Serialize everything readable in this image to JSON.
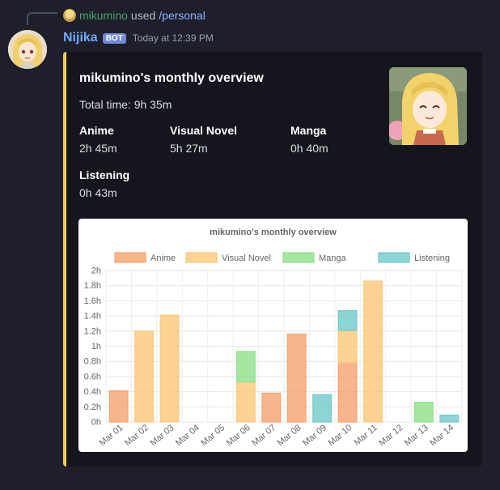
{
  "reply": {
    "user": "mikumino",
    "used": "used",
    "command": "/personal"
  },
  "message": {
    "author": "Nijika",
    "bot_tag": "BOT",
    "timestamp": "Today at 12:39 PM"
  },
  "embed": {
    "accent_color": "#f2cc5b",
    "title": "mikumino's monthly overview",
    "description": "Total time: 9h 35m",
    "fields": [
      {
        "name": "Anime",
        "value": "2h 45m"
      },
      {
        "name": "Visual Novel",
        "value": "5h 27m"
      },
      {
        "name": "Manga",
        "value": "0h 40m"
      },
      {
        "name": "Listening",
        "value": "0h 43m"
      }
    ]
  },
  "chart_data": {
    "type": "bar",
    "stacked": true,
    "title": "mikumino's monthly overview",
    "categories": [
      "Mar 01",
      "Mar 02",
      "Mar 03",
      "Mar 04",
      "Mar 05",
      "Mar 06",
      "Mar 07",
      "Mar 08",
      "Mar 09",
      "Mar 10",
      "Mar 11",
      "Mar 12",
      "Mar 13",
      "Mar 14"
    ],
    "yticks": [
      "0h",
      "0.2h",
      "0.4h",
      "0.6h",
      "0.8h",
      "1h",
      "1.2h",
      "1.4h",
      "1.6h",
      "1.8h",
      "2h"
    ],
    "ylim": [
      0,
      2
    ],
    "grid": true,
    "legend_position": "top",
    "series": [
      {
        "name": "Anime",
        "color": "#f5a26f",
        "values": [
          0.41,
          0,
          0,
          0,
          0,
          0,
          0.38,
          1.16,
          0,
          0.78,
          0,
          0,
          0,
          0
        ]
      },
      {
        "name": "Visual Novel",
        "color": "#fcc878",
        "values": [
          0,
          1.2,
          1.41,
          0,
          0,
          0.53,
          0,
          0,
          0,
          0.43,
          1.86,
          0,
          0,
          0
        ]
      },
      {
        "name": "Manga",
        "color": "#8ee08a",
        "values": [
          0,
          0,
          0,
          0,
          0,
          0.4,
          0,
          0,
          0,
          0,
          0,
          0,
          0.26,
          0
        ]
      },
      {
        "name": "Listening",
        "color": "#6fcac9",
        "values": [
          0,
          0,
          0,
          0,
          0,
          0,
          0,
          0,
          0.36,
          0.26,
          0,
          0,
          0,
          0.09
        ]
      }
    ]
  }
}
